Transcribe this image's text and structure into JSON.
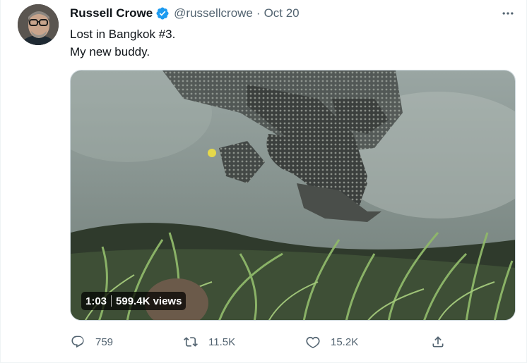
{
  "tweet": {
    "author": {
      "display_name": "Russell Crowe",
      "handle": "@russellcrowe",
      "verified": true,
      "date": "Oct 20"
    },
    "text_lines": [
      "Lost in Bangkok #3.",
      "My new buddy."
    ],
    "media": {
      "type": "video",
      "duration": "1:03",
      "views": "599.4K views"
    },
    "actions": {
      "replies": "759",
      "retweets": "11.5K",
      "likes": "15.2K"
    }
  },
  "icons": {
    "more": "more-horizontal-icon",
    "verified": "verified-badge-icon",
    "reply": "reply-icon",
    "retweet": "retweet-icon",
    "like": "heart-icon",
    "share": "share-icon"
  },
  "colors": {
    "text_primary": "#0f1419",
    "text_secondary": "#536471",
    "verified_blue": "#1d9bf0"
  }
}
